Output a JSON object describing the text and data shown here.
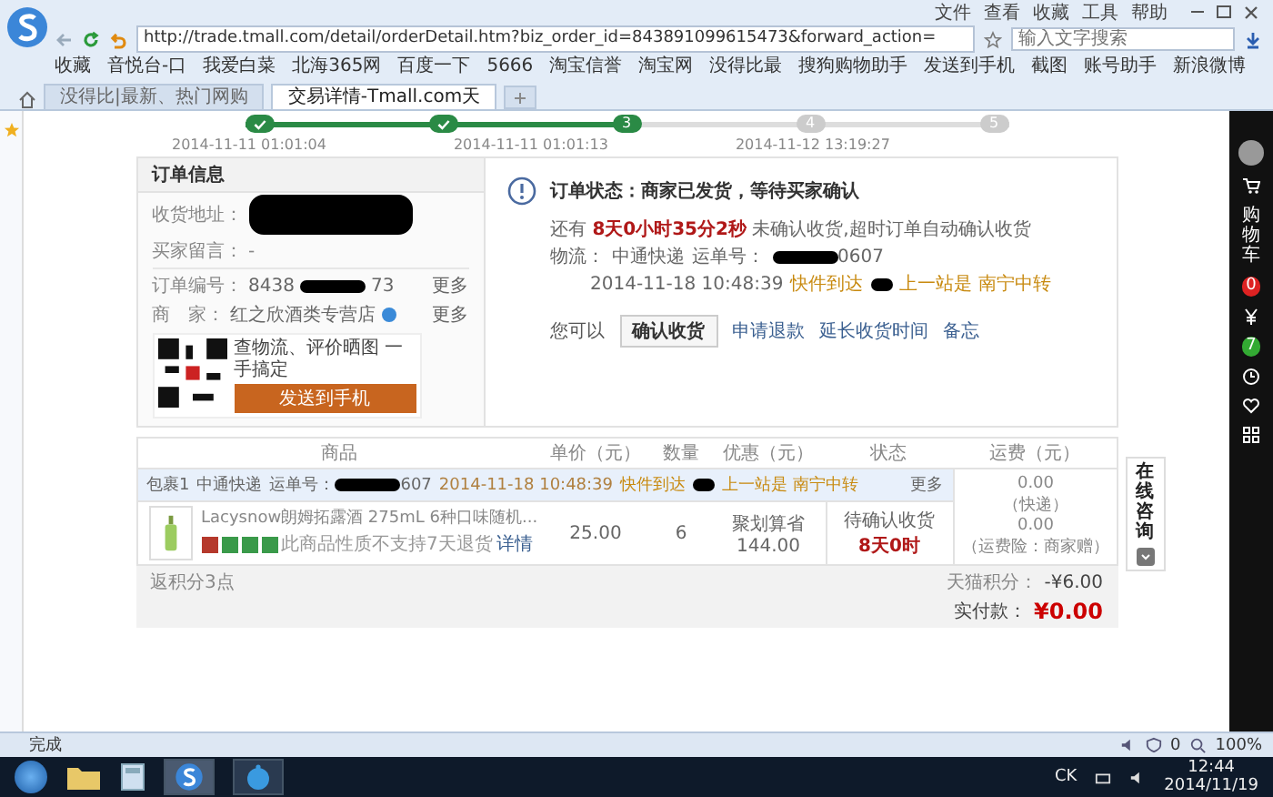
{
  "browser": {
    "menu": [
      "文件",
      "查看",
      "收藏",
      "工具",
      "帮助"
    ],
    "url": "http://trade.tmall.com/detail/orderDetail.htm?biz_order_id=843891099615473&forward_action=",
    "search": {
      "placeholder": "输入文字搜索"
    },
    "bookmarks": [
      "收藏",
      "音悦台-口",
      "我爱白菜",
      "北海365网",
      "百度一下",
      "5666",
      "淘宝信誉",
      "淘宝网",
      "没得比最",
      "搜狗购物助手",
      "发送到手机",
      "截图",
      "账号助手",
      "新浪微博"
    ]
  },
  "tabs": [
    {
      "label": "没得比|最新、热门网购",
      "selected": false
    },
    {
      "label": "交易详情-Tmall.com天",
      "selected": true
    }
  ],
  "progress": {
    "steps": [
      {
        "done": true
      },
      {
        "done": true
      },
      {
        "number": "3",
        "done": true
      },
      {
        "number": "4",
        "done": false
      },
      {
        "number": "5",
        "done": false
      }
    ],
    "dates": [
      "2014-11-11 01:01:04",
      "2014-11-11 01:01:13",
      "2014-11-12 13:19:27"
    ]
  },
  "order_info": {
    "title": "订单信息",
    "address_label": "收货地址：",
    "message_label": "买家留言：",
    "message": "-",
    "number_label": "订单编号：",
    "number_start": "8438",
    "number_end": "73",
    "merchant_label": "商　家：",
    "merchant": "红之欣酒类专营店",
    "more": [
      "更多",
      "更多"
    ],
    "qr_text": "查物流、评价晒图 一手搞定",
    "qr_button": "发送到手机"
  },
  "status": {
    "title": "订单状态：商家已发货，等待买家确认",
    "countdown": "还有 **8天0小时35分2秒** 未确认收货,超时订单自动确认收货",
    "logistics_label": "物流：",
    "carrier": "中通快递",
    "waybill_label": "运单号：",
    "waybill_end": "0607",
    "time": "2014-11-18 10:48:39",
    "event": "快件到达",
    "last_station": "上一站是 南宁中转",
    "actions_label": "您可以",
    "confirm": "确认收货",
    "links": [
      "申请退款",
      "延长收货时间",
      "备忘"
    ]
  },
  "table": {
    "columns": [
      "商品",
      "单价（元）",
      "数量",
      "优惠（元）",
      "状态",
      "运费（元）"
    ],
    "package": {
      "label": "包裹1",
      "carrier": "中通快递",
      "waybill_label": "运单号：",
      "waybill_end": "607",
      "time": "2014-11-18 10:48:39",
      "event": "快件到达",
      "last_station": "上一站是 南宁中转",
      "more": "更多"
    },
    "item": {
      "name": "Lacysnow朗姆拓露酒 275mL 6种口味随机...",
      "tags": [
        {
          "color": "#b5392c"
        },
        {
          "color": "#3a9a4a"
        },
        {
          "color": "#3a9a4a"
        },
        {
          "color": "#3a9a4a"
        }
      ],
      "note": "此商品性质不支持7天退货",
      "detail_link": "详情",
      "price": "25.00",
      "quantity": "6",
      "discount_label": "聚划算省",
      "discount": "144.00",
      "status": "待确认收货",
      "status_time": "8天0时"
    },
    "shipping": {
      "fee": "0.00",
      "fee_type": "（快递）",
      "insurance": "0.00",
      "insurance_note": "（运费险：商家赠）"
    }
  },
  "summary": {
    "points": "返积分3点",
    "tmall_points_label": "天猫积分：",
    "tmall_points": "-¥6.00",
    "paid_label": "实付款：",
    "paid": "¥0.00"
  },
  "consult": "在线咨询",
  "right_bar": {
    "cart": "购物车",
    "cart_count": "0",
    "notice_count": "7"
  },
  "status_bar": {
    "text": "完成",
    "count": "0",
    "zoom": "100%"
  },
  "taskbar": {
    "lang": "CK",
    "time": "12:44",
    "date": "2014/11/19"
  }
}
